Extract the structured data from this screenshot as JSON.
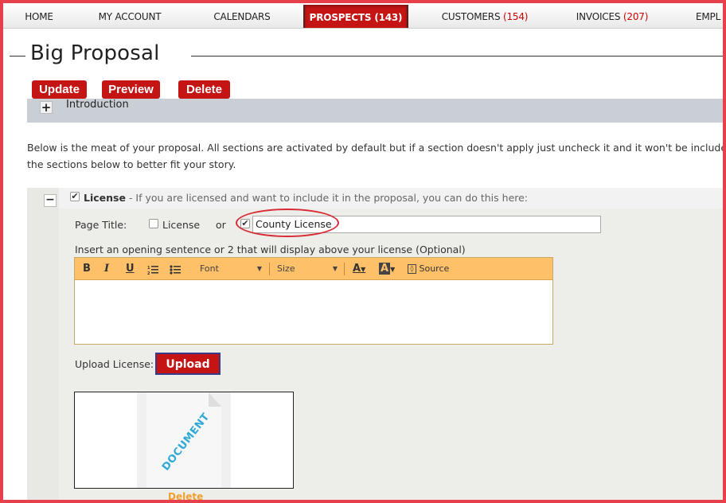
{
  "nav": {
    "items": [
      {
        "label": "HOME",
        "count": ""
      },
      {
        "label": "MY ACCOUNT",
        "count": ""
      },
      {
        "label": "CALENDARS",
        "count": ""
      },
      {
        "label": "PROSPECTS",
        "count": "(143)"
      },
      {
        "label": "CUSTOMERS",
        "count": "(154)"
      },
      {
        "label": "INVOICES",
        "count": "(207)"
      },
      {
        "label": "EMPL",
        "count": ""
      }
    ],
    "active": "PROSPECTS"
  },
  "page": {
    "title": "Big Proposal"
  },
  "actions": {
    "update_label": "Update",
    "preview_label": "Preview",
    "delete_label": "Delete"
  },
  "intro": {
    "expand_glyph": "+",
    "label": "Introduction"
  },
  "description": {
    "line1": "Below is the meat of your proposal. All sections are activated by default but if a section doesn't apply just uncheck it and it won't be included in th",
    "line2": "the sections below to better fit your story."
  },
  "license_section": {
    "collapse_glyph": "−",
    "enabled_checked": true,
    "heading": "License",
    "subtitle": " - If you are licensed and want to include it in the proposal, you can do this here:",
    "page_title_label": "Page Title:",
    "option_license_label": "License",
    "option_license_checked": false,
    "or_label": "or",
    "custom_checked": true,
    "custom_title_value": "County License",
    "editor_prompt": "Insert an opening sentence or 2 that will display above your license (Optional)",
    "upload_label": "Upload License:",
    "upload_button": "Upload",
    "document_word": "DOCUMENT",
    "delete_link": "Delete"
  },
  "editor_toolbar": {
    "bold": "B",
    "italic": "I",
    "underline": "U",
    "font_label": "Font",
    "size_label": "Size",
    "text_color": "A",
    "bg_color": "A",
    "source_label": "Source"
  },
  "colors": {
    "brand_red": "#c41414",
    "frame_red": "#e8404a",
    "toolbar_orange": "#ffc06a",
    "highlight_oval": "#d92a36"
  }
}
